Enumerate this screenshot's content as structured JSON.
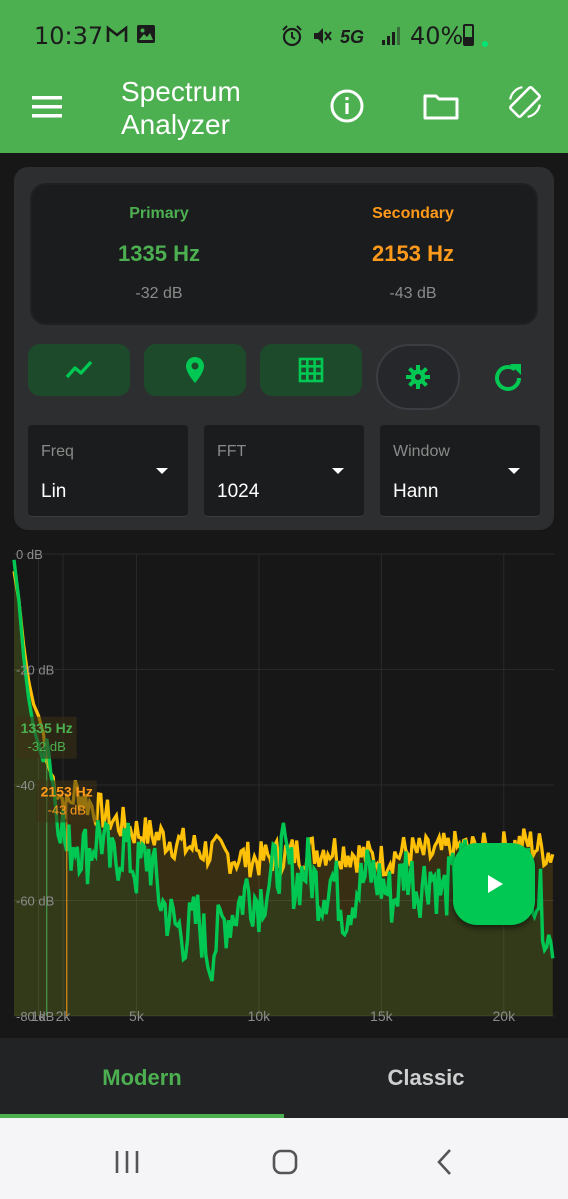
{
  "status_bar": {
    "time": "10:37",
    "battery": "40%",
    "left_icons": [
      "gmail-icon",
      "image-icon"
    ],
    "right_icons": [
      "alarm-icon",
      "mute-icon",
      "5g-icon",
      "signal-icon",
      "battery-icon"
    ],
    "network_label": "5G"
  },
  "appbar": {
    "title": "Spectrum Analyzer",
    "icons": [
      "menu-icon",
      "info-icon",
      "folder-icon",
      "screen-rotation-icon"
    ]
  },
  "readout": {
    "primary_label": "Primary",
    "primary_freq": "1335 Hz",
    "primary_db": "-32 dB",
    "secondary_label": "Secondary",
    "secondary_freq": "2153 Hz",
    "secondary_db": "-43 dB"
  },
  "tools": {
    "icons": [
      "line-chart-icon",
      "map-pin-icon",
      "grid-icon",
      "gear-icon",
      "refresh-icon"
    ]
  },
  "selects": [
    {
      "label": "Freq",
      "value": "Lin"
    },
    {
      "label": "FFT",
      "value": "1024"
    },
    {
      "label": "Window",
      "value": "Hann"
    }
  ],
  "chart_data": {
    "type": "area",
    "x_unit": "Hz",
    "y_unit": "dB",
    "xlim": [
      0,
      22050
    ],
    "ylim": [
      -80,
      0
    ],
    "x_ticks": [
      1000,
      2000,
      5000,
      10000,
      15000,
      20000
    ],
    "x_tick_labels": [
      "1k",
      "2k",
      "5k",
      "10k",
      "15k",
      "20k"
    ],
    "y_ticks": [
      0,
      -20,
      -40,
      -60,
      -80
    ],
    "y_tick_labels": [
      "0 dB",
      "-20 dB",
      "-40",
      "-60 dB",
      "-80 dB"
    ],
    "grid": true,
    "markers": [
      {
        "name": "Primary",
        "freq": 1335,
        "db": -32,
        "label": "1335 Hz",
        "sublabel": "-32 dB",
        "color": "#4caf50"
      },
      {
        "name": "Secondary",
        "freq": 2153,
        "db": -43,
        "label": "2153 Hz",
        "sublabel": "-43 dB",
        "color": "#ff9a1a"
      }
    ],
    "series": [
      {
        "color": "#ffc107",
        "x": [
          0,
          200,
          400,
          600,
          800,
          1000,
          1200,
          1335,
          1600,
          2153,
          2500,
          3000,
          4000,
          5000,
          6000,
          7000,
          8000,
          9000,
          10000,
          11000,
          12000,
          13000,
          14000,
          15000,
          16000,
          17000,
          18000,
          19000,
          20000,
          21000,
          22000
        ],
        "y": [
          -3,
          -8,
          -16,
          -22,
          -26,
          -28,
          -31,
          -36,
          -39,
          -44,
          -41,
          -43,
          -46,
          -48,
          -49,
          -50.5,
          -51.5,
          -52.5,
          -53,
          -52,
          -51.5,
          -51,
          -52,
          -53,
          -51.5,
          -52,
          -51,
          -51.5,
          -51,
          -50,
          -52
        ]
      },
      {
        "color": "#00c853",
        "x": [
          0,
          200,
          400,
          600,
          800,
          1000,
          1200,
          1335,
          1600,
          2000,
          2153,
          2500,
          3000,
          3500,
          4000,
          4500,
          5000,
          5500,
          6000,
          6500,
          7000,
          7500,
          8000,
          8500,
          9000,
          9500,
          10000,
          10500,
          11000,
          11500,
          12000,
          12500,
          13000,
          13500,
          14000,
          14500,
          15000,
          15500,
          16000,
          16500,
          17000,
          17500,
          18000,
          18500,
          19000,
          19500,
          20000,
          20500,
          21000,
          21500,
          22000
        ],
        "y": [
          -1,
          -8,
          -18,
          -25,
          -30,
          -33,
          -36,
          -32,
          -40,
          -47,
          -52,
          -49,
          -52,
          -48,
          -54,
          -50,
          -55,
          -52,
          -60,
          -64,
          -66,
          -63,
          -70,
          -64,
          -62,
          -58,
          -60,
          -56,
          -52,
          -57,
          -54,
          -59,
          -56,
          -62,
          -58,
          -55,
          -57,
          -60,
          -54,
          -58,
          -55,
          -59,
          -56,
          -53,
          -57,
          -55,
          -58,
          -56,
          -55,
          -60,
          -70
        ]
      }
    ]
  },
  "fab": {
    "icon": "play-icon"
  },
  "bottom_tabs": {
    "modern": "Modern",
    "classic": "Classic",
    "active": "Modern"
  },
  "nav_bar": {
    "icons": [
      "recent-apps-icon",
      "home-icon",
      "back-icon"
    ]
  },
  "colors": {
    "accent": "#4caf50",
    "primary": "#00c853",
    "secondary": "#ffc107",
    "secondary_text": "#ff9a1a"
  }
}
